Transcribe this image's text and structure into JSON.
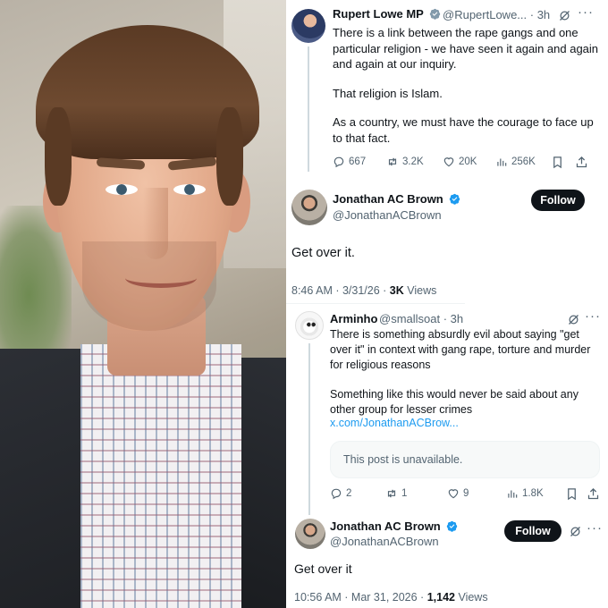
{
  "post1": {
    "author": "Rupert Lowe MP",
    "handle": "@RupertLowe...",
    "time": "· 3h",
    "paragraphs": [
      "There is a link between the rape gangs and one particular religion - we have seen it again and again and again at our inquiry.",
      "That religion is Islam.",
      "As a country, we must have the courage to face up to that fact."
    ],
    "replies": "667",
    "reposts": "3.2K",
    "likes": "20K",
    "views": "256K"
  },
  "post2": {
    "author": "Jonathan AC Brown",
    "handle": "@JonathanACBrown",
    "follow_label": "Follow",
    "text": "Get over it.",
    "timestamp": "8:46 AM · 3/31/26 · ",
    "views_count": "3K",
    "views_label": " Views"
  },
  "post3": {
    "author": "Arminho",
    "handle": "@smallsoat",
    "time": "· 3h",
    "paragraphs": [
      "There is something absurdly evil about saying \"get over it\" in context with gang rape, torture and murder for religious reasons",
      "Something like this would never be said about any other group for lesser crimes"
    ],
    "link": "x.com/JonathanACBrow...",
    "unavailable": "This post is unavailable.",
    "replies": "2",
    "reposts": "1",
    "likes": "9",
    "views": "1.8K"
  },
  "post4": {
    "author": "Jonathan AC Brown",
    "handle": "@JonathanACBrown",
    "follow_label": "Follow",
    "text": "Get over it",
    "timestamp": "10:56 AM · Mar 31, 2026 · ",
    "views_count": "1,142",
    "views_label": " Views"
  },
  "colors": {
    "verified_blue": "#1d9bf0",
    "text_primary": "#0f1419",
    "text_secondary": "#536471",
    "follow_bg": "#0f1419"
  },
  "icons": [
    "verified-badge-icon",
    "grok-icon",
    "more-icon",
    "reply-icon",
    "repost-icon",
    "like-icon",
    "views-icon",
    "bookmark-icon",
    "share-icon"
  ]
}
